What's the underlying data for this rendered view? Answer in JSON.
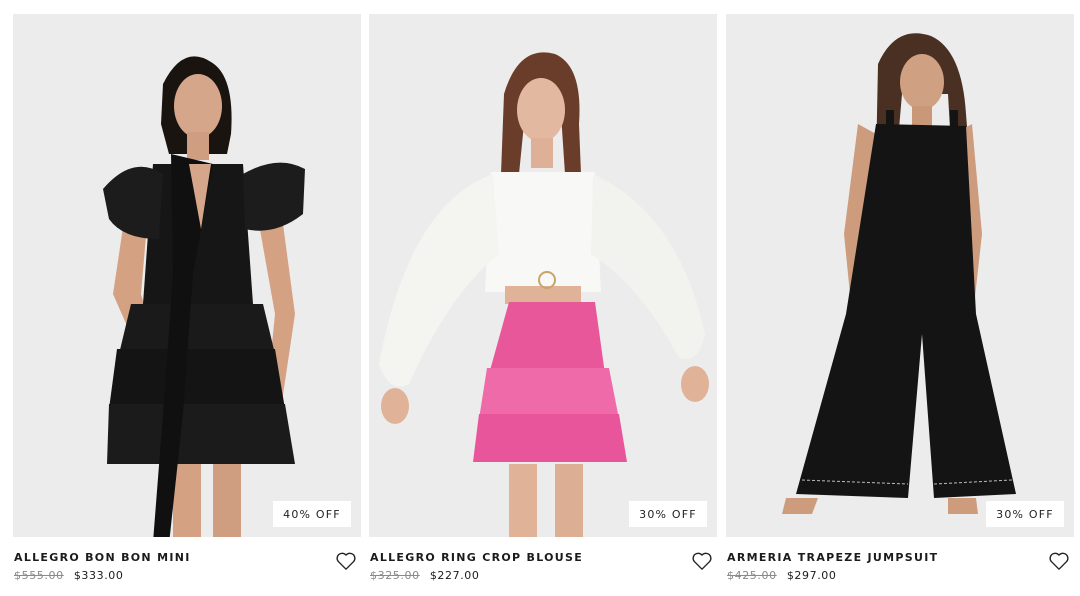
{
  "products": [
    {
      "name": "ALLEGRO BON BON MINI",
      "original_price": "$555.00",
      "sale_price": "$333.00",
      "badge": "40% OFF",
      "image_alt": "Model wearing black ruffled mini dress with neck scarf",
      "wishlist_icon": "heart-outline-icon"
    },
    {
      "name": "ALLEGRO RING CROP BLOUSE",
      "original_price": "$325.00",
      "sale_price": "$227.00",
      "badge": "30% OFF",
      "image_alt": "Model wearing white balloon sleeve crop blouse and pink ruffled skirt",
      "wishlist_icon": "heart-outline-icon"
    },
    {
      "name": "ARMERIA TRAPEZE JUMPSUIT",
      "original_price": "$425.00",
      "sale_price": "$297.00",
      "badge": "30% OFF",
      "image_alt": "Model wearing black wide-leg trapeze jumpsuit",
      "wishlist_icon": "heart-outline-icon"
    }
  ],
  "colors": {
    "photo_background": "#ececec",
    "text": "#1b1b1b",
    "strike_price": "#8a8a8a",
    "garment_black": "#151515",
    "garment_pink": "#e8559a",
    "garment_white": "#f7f7f5",
    "skin": "#d9a98a"
  }
}
